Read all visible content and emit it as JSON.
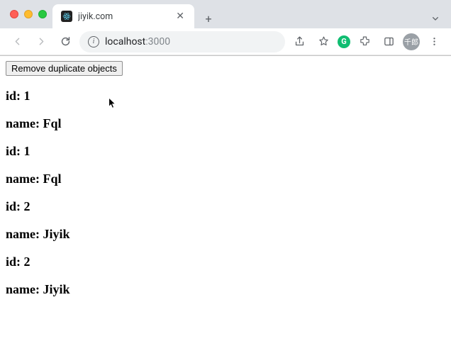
{
  "browser": {
    "tab": {
      "title": "jiyik.com"
    },
    "newtab_label": "+",
    "address": {
      "host": "localhost",
      "port": ":3000"
    },
    "avatar_text": "千郎",
    "ext_letter": "G"
  },
  "page": {
    "button_label": "Remove duplicate objects",
    "entries": [
      {
        "id_label": "id: 1",
        "name_label": "name: Fql"
      },
      {
        "id_label": "id: 1",
        "name_label": "name: Fql"
      },
      {
        "id_label": "id: 2",
        "name_label": "name: Jiyik"
      },
      {
        "id_label": "id: 2",
        "name_label": "name: Jiyik"
      }
    ]
  }
}
